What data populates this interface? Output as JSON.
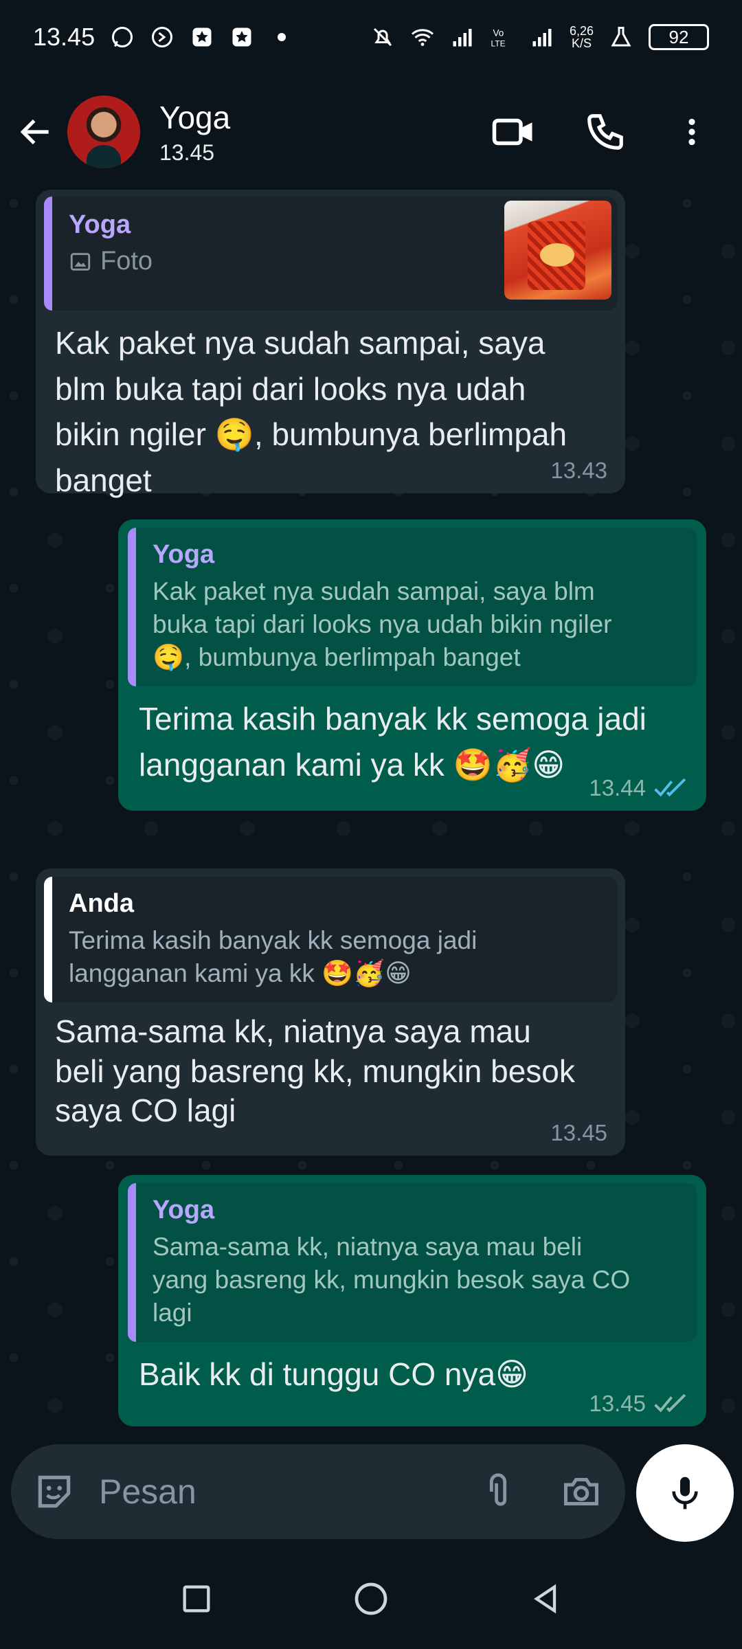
{
  "status_bar": {
    "time": "13.45",
    "net_speed_top": "6,26",
    "net_speed_bottom": "K/S",
    "battery": "92",
    "icons": [
      "whatsapp-icon",
      "shazam-icon",
      "star-app-icon",
      "star-app-icon",
      "dot-icon",
      "mute-icon",
      "wifi-icon",
      "signal-icon",
      "volte-icon",
      "signal-icon",
      "flask-icon"
    ]
  },
  "header": {
    "contact_name": "Yoga",
    "subtitle": "13.45",
    "actions": [
      "video-call-icon",
      "voice-call-icon",
      "more-icon"
    ]
  },
  "messages": [
    {
      "direction": "in",
      "quote_author": "Yoga",
      "quote_type": "Foto",
      "text_line1": "Kak paket nya sudah sampai, saya",
      "text_line2": "blm buka tapi dari looks nya udah",
      "text_line3": "bikin ngiler 🤤, bumbunya berlimpah",
      "text_line4": "banget",
      "time": "13.43"
    },
    {
      "direction": "out",
      "quote_author": "Yoga",
      "quote_line1": "Kak paket nya sudah sampai, saya blm",
      "quote_line2": "buka tapi dari looks nya udah bikin ngiler",
      "quote_line3": "🤤, bumbunya berlimpah banget",
      "text_line1": "Terima kasih banyak kk semoga jadi",
      "text_line2": "langganan kami ya kk 🤩🥳😁",
      "time": "13.44",
      "status": "read"
    },
    {
      "direction": "in",
      "quote_author": "Anda",
      "quote_line1": "Terima kasih banyak kk semoga jadi",
      "quote_line2": "langganan kami ya kk 🤩🥳😁",
      "text_line1": "Sama-sama kk, niatnya saya mau",
      "text_line2": "beli yang basreng kk, mungkin besok",
      "text_line3": "saya CO lagi",
      "time": "13.45"
    },
    {
      "direction": "out",
      "quote_author": "Yoga",
      "quote_line1": "Sama-sama kk, niatnya saya mau beli",
      "quote_line2": "yang basreng kk, mungkin besok saya CO",
      "quote_line3": "lagi",
      "text_line1": "Baik kk di tunggu CO nya😁",
      "time": "13.45",
      "status": "delivered"
    }
  ],
  "composer": {
    "placeholder": "Pesan"
  },
  "colors": {
    "background": "#0b141a",
    "incoming_bubble": "#202c33",
    "outgoing_bubble": "#005c4b",
    "read_ticks": "#53bdeb"
  }
}
